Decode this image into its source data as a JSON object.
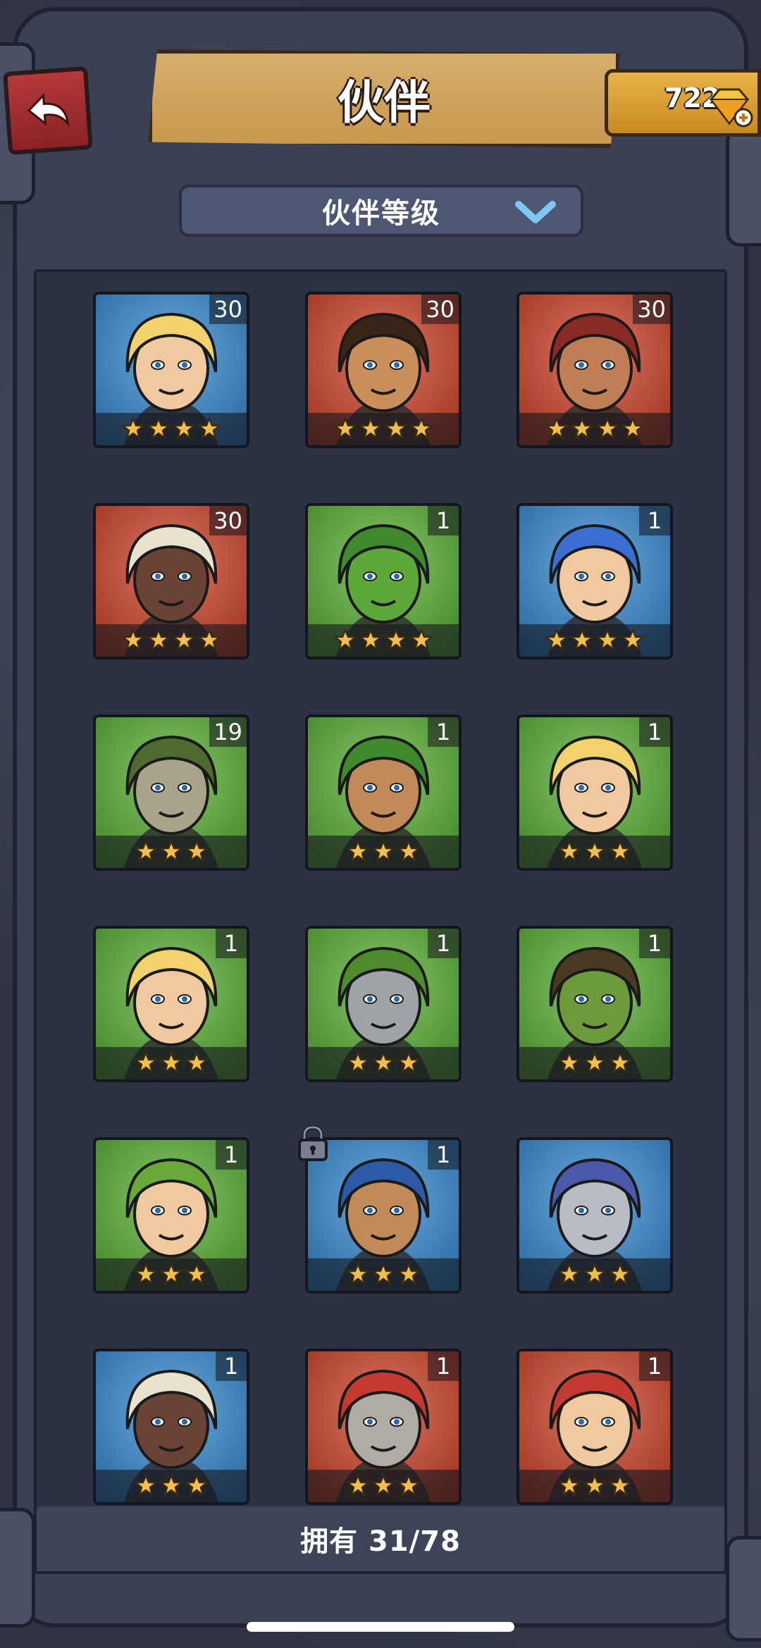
{
  "header": {
    "title": "伙伴",
    "gems": "722"
  },
  "filter": {
    "label": "伙伴等级"
  },
  "footer": {
    "owned": "拥有 31/78"
  },
  "companions": [
    {
      "level": "30",
      "stars": 4,
      "bg": "#3a8fd6",
      "hair": "#f2d36b",
      "skin": "#f0c9a0"
    },
    {
      "level": "30",
      "stars": 4,
      "bg": "#d6482e",
      "hair": "#3a2418",
      "skin": "#c98e5a"
    },
    {
      "level": "30",
      "stars": 4,
      "bg": "#d6482e",
      "hair": "#8a2a24",
      "skin": "#c07d56"
    },
    {
      "level": "30",
      "stars": 4,
      "bg": "#d6482e",
      "hair": "#e8e2cf",
      "skin": "#6b4334"
    },
    {
      "level": "1",
      "stars": 4,
      "bg": "#5fb53a",
      "hair": "#3f8a2e",
      "skin": "#5ca83b"
    },
    {
      "level": "1",
      "stars": 4,
      "bg": "#3a8fd6",
      "hair": "#3a6ed0",
      "skin": "#f0c9a0"
    },
    {
      "level": "19",
      "stars": 3,
      "bg": "#5fb53a",
      "hair": "#4f6a2e",
      "skin": "#a8a48a"
    },
    {
      "level": "1",
      "stars": 3,
      "bg": "#5fb53a",
      "hair": "#3f8a2e",
      "skin": "#c08a5a"
    },
    {
      "level": "1",
      "stars": 3,
      "bg": "#5fb53a",
      "hair": "#f2d36b",
      "skin": "#f0c9a0"
    },
    {
      "level": "1",
      "stars": 3,
      "bg": "#5fb53a",
      "hair": "#f2d36b",
      "skin": "#f0c9a0"
    },
    {
      "level": "1",
      "stars": 3,
      "bg": "#5fb53a",
      "hair": "#4f8a2e",
      "skin": "#a0a4a8"
    },
    {
      "level": "1",
      "stars": 3,
      "bg": "#5fb53a",
      "hair": "#4a3a24",
      "skin": "#6d9a3a"
    },
    {
      "level": "1",
      "stars": 3,
      "bg": "#5fb53a",
      "hair": "#6aa83a",
      "skin": "#f0c9a0"
    },
    {
      "level": "1",
      "stars": 3,
      "bg": "#3a8fd6",
      "hair": "#2d5aa8",
      "skin": "#c08a5a",
      "locked": true
    },
    {
      "level": "",
      "stars": 3,
      "bg": "#3a8fd6",
      "hair": "#4a5aa8",
      "skin": "#b8bcc4"
    },
    {
      "level": "1",
      "stars": 3,
      "bg": "#3a8fd6",
      "hair": "#e8e2cf",
      "skin": "#6b4334"
    },
    {
      "level": "1",
      "stars": 3,
      "bg": "#d6482e",
      "hair": "#c43a30",
      "skin": "#b0aca4"
    },
    {
      "level": "1",
      "stars": 3,
      "bg": "#d6482e",
      "hair": "#c43a30",
      "skin": "#f0c9a0"
    }
  ]
}
